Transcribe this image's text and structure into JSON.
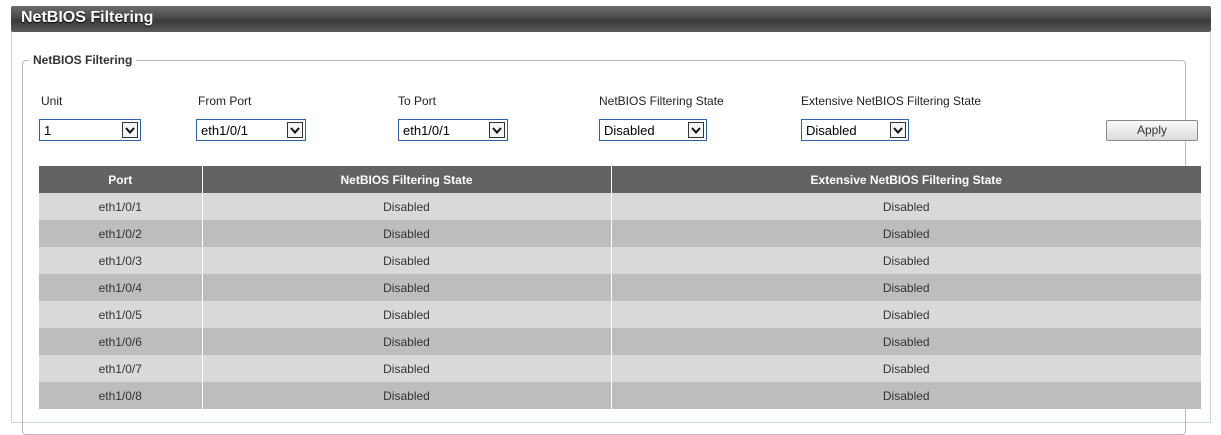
{
  "page": {
    "title": "NetBIOS Filtering"
  },
  "group": {
    "legend": "NetBIOS Filtering"
  },
  "form": {
    "unit": {
      "label": "Unit",
      "value": "1"
    },
    "from_port": {
      "label": "From Port",
      "value": "eth1/0/1"
    },
    "to_port": {
      "label": "To Port",
      "value": "eth1/0/1"
    },
    "state": {
      "label": "NetBIOS Filtering State",
      "value": "Disabled"
    },
    "ext_state": {
      "label": "Extensive NetBIOS Filtering State",
      "value": "Disabled"
    },
    "apply_label": "Apply"
  },
  "table": {
    "headers": [
      "Port",
      "NetBIOS Filtering State",
      "Extensive NetBIOS Filtering State"
    ],
    "rows": [
      [
        "eth1/0/1",
        "Disabled",
        "Disabled"
      ],
      [
        "eth1/0/2",
        "Disabled",
        "Disabled"
      ],
      [
        "eth1/0/3",
        "Disabled",
        "Disabled"
      ],
      [
        "eth1/0/4",
        "Disabled",
        "Disabled"
      ],
      [
        "eth1/0/5",
        "Disabled",
        "Disabled"
      ],
      [
        "eth1/0/6",
        "Disabled",
        "Disabled"
      ],
      [
        "eth1/0/7",
        "Disabled",
        "Disabled"
      ],
      [
        "eth1/0/8",
        "Disabled",
        "Disabled"
      ]
    ]
  },
  "icons": {
    "dropdown": "chevron-down-icon"
  }
}
